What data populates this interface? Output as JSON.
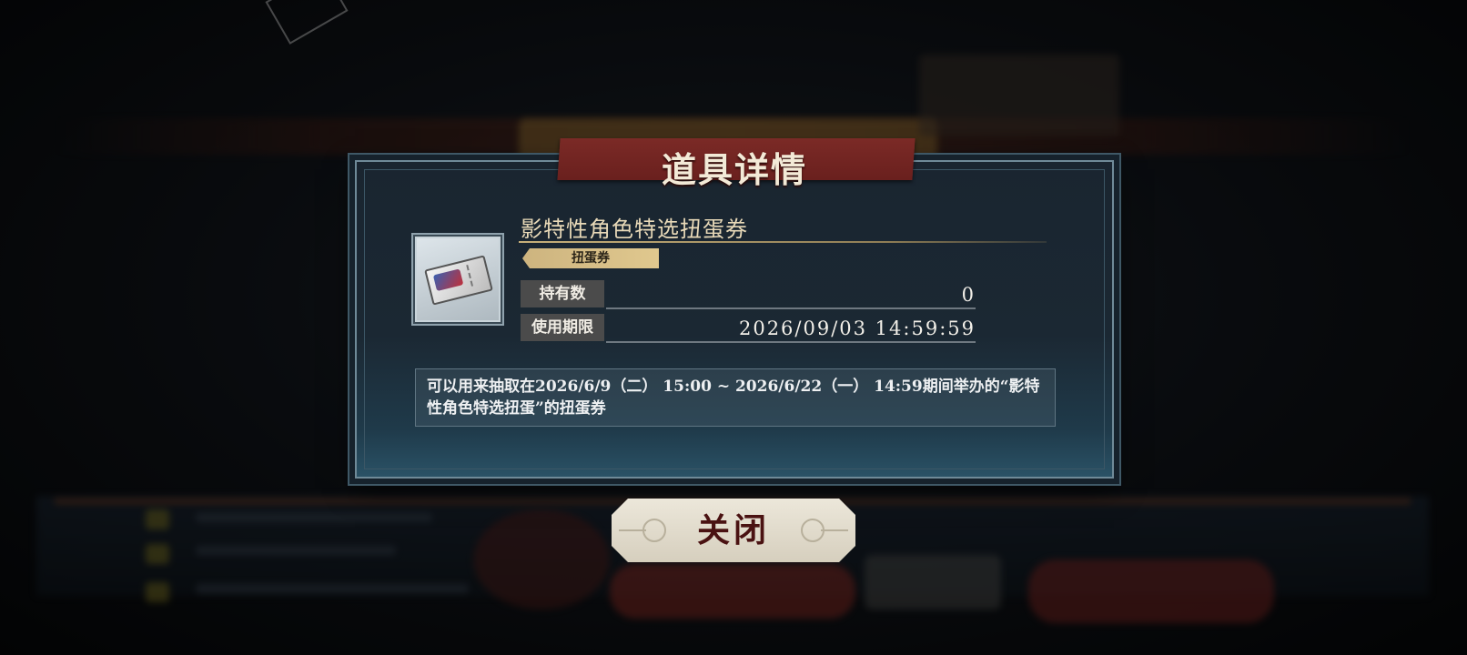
{
  "dialog": {
    "title": "道具详情",
    "item": {
      "name": "影特性角色特选扭蛋券",
      "category": "扭蛋券",
      "icon": "gacha-ticket-icon"
    },
    "stats": [
      {
        "label": "持有数",
        "value": "0"
      },
      {
        "label": "使用期限",
        "value": "2026/09/03 14:59:59"
      }
    ],
    "description": "可以用来抽取在2026/6/9（二） 15:00 ~ 2026/6/22（一） 14:59期间举办的“影特性角色特选扭蛋”的扭蛋券",
    "close_label": "关闭"
  },
  "colors": {
    "title_banner": "#7b2a26",
    "dialog_bg": "#1a2530",
    "tag_gold": "#d8bf88",
    "close_text": "#4a1212"
  }
}
